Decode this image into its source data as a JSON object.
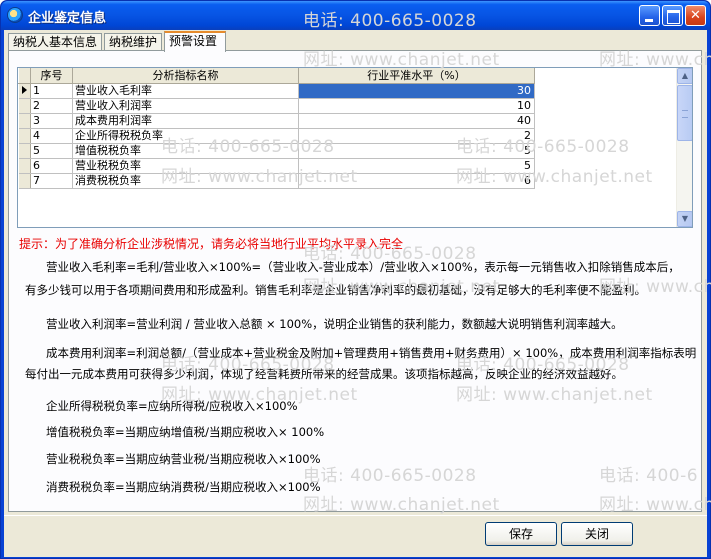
{
  "window": {
    "title": "企业鉴定信息"
  },
  "tabs": [
    {
      "label": "纳税人基本信息"
    },
    {
      "label": "纳税维护"
    },
    {
      "label": "预警设置"
    }
  ],
  "grid": {
    "columns": [
      "序号",
      "分析指标名称",
      "行业平准水平（%）"
    ],
    "rows": [
      {
        "no": "1",
        "name": "营业收入毛利率",
        "value": "30"
      },
      {
        "no": "2",
        "name": "营业收入利润率",
        "value": "10"
      },
      {
        "no": "3",
        "name": "成本费用利润率",
        "value": "40"
      },
      {
        "no": "4",
        "name": "企业所得税税负率",
        "value": "2"
      },
      {
        "no": "5",
        "name": "增值税税负率",
        "value": "5"
      },
      {
        "no": "6",
        "name": "营业税税负率",
        "value": "5"
      },
      {
        "no": "7",
        "name": "消费税税负率",
        "value": "6"
      }
    ]
  },
  "hint": "提示：为了准确分析企业涉税情况，请务必将当地行业平均水平录入完全",
  "descriptions": {
    "p1a": "营业收入毛利率=毛利/营业收入×100%=（营业收入-营业成本）/营业收入×100%，表示每一元销售收入扣除销售成本后，",
    "p1b": "有多少钱可以用于各项期间费用和形成盈利。销售毛利率是企业销售净利率的最初基础，没有足够大的毛利率便不能盈利。",
    "p2": "营业收入利润率=营业利润 / 营业收入总额 × 100%，说明企业销售的获利能力，数额越大说明销售利润率越大。",
    "p3a": "成本费用利润率=利润总额/（营业成本+营业税金及附加+管理费用+销售费用+财务费用）× 100%，成本费用利润率指标表明",
    "p3b": "每付出一元成本费用可获得多少利润，体现了经营耗费所带来的经营成果。该项指标越高，反映企业的经济效益越好。",
    "p4": "企业所得税税负率=应纳所得税/应税收入×100%",
    "p5": "增值税税负率=当期应纳增值税/当期应税收入× 100%",
    "p6": "营业税税负率=当期应纳营业税/当期应税收入×100%",
    "p7": "消费税税负率=当期应纳消费税/当期应税收入×100%"
  },
  "watermarks": {
    "phone": "电话: 400-665-0028",
    "site": "网址: www.chanjet.net",
    "site_short": "网址: www.cha",
    "phone_short": "电话: 400-6"
  },
  "buttons": {
    "save": "保存",
    "close": "关闭"
  }
}
